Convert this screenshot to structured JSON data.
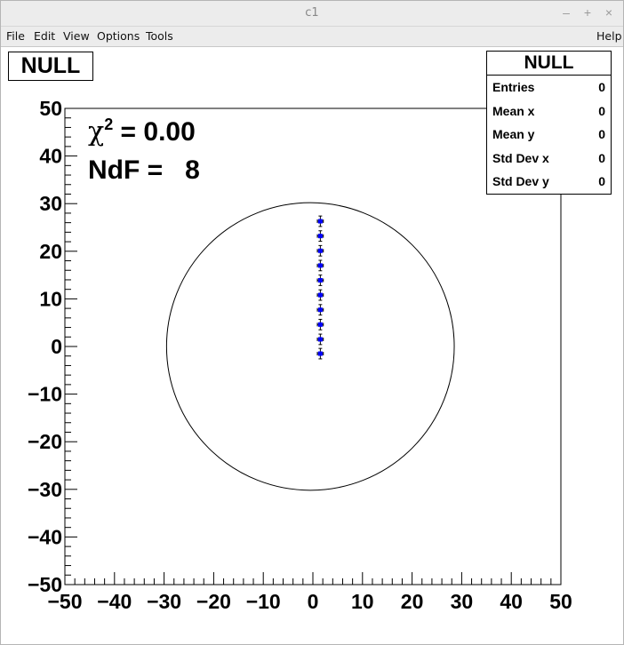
{
  "window": {
    "title": "c1",
    "buttons": [
      "–",
      "+",
      "×"
    ]
  },
  "menu": {
    "file": "File",
    "edit": "Edit",
    "view": "View",
    "options": "Options",
    "tools": "Tools",
    "help": "Help"
  },
  "histogram_title": "NULL",
  "stats": {
    "title": "NULL",
    "rows": [
      {
        "label": "Entries",
        "value": "0"
      },
      {
        "label": "Mean x",
        "value": "0"
      },
      {
        "label": "Mean y",
        "value": "0"
      },
      {
        "label": "Std Dev x",
        "value": "0"
      },
      {
        "label": "Std Dev y",
        "value": "0"
      }
    ]
  },
  "fit": {
    "chi2_symbol": "χ",
    "chi2_sup": "2",
    "chi2_value": " = 0.00",
    "ndf_line": "NdF =   8"
  },
  "colors": {
    "marker": "#0000ff",
    "axis": "#000000",
    "circle": "#000000"
  },
  "chart_data": {
    "type": "scatter",
    "title": "NULL",
    "xlabel": "",
    "ylabel": "",
    "xlim": [
      -50,
      50
    ],
    "ylim": [
      -50,
      50
    ],
    "x_ticks": [
      -50,
      -40,
      -30,
      -20,
      -10,
      0,
      10,
      20,
      30,
      40,
      50
    ],
    "y_ticks": [
      -50,
      -40,
      -30,
      -20,
      -10,
      0,
      10,
      20,
      30,
      40,
      50
    ],
    "series": [
      {
        "points": [
          {
            "x": 1.5,
            "y": -1.5
          },
          {
            "x": 1.5,
            "y": 1.5
          },
          {
            "x": 1.5,
            "y": 4.6
          },
          {
            "x": 1.5,
            "y": 7.7
          },
          {
            "x": 1.5,
            "y": 10.8
          },
          {
            "x": 1.5,
            "y": 13.9
          },
          {
            "x": 1.5,
            "y": 17.0
          },
          {
            "x": 1.5,
            "y": 20.1
          },
          {
            "x": 1.5,
            "y": 23.2
          },
          {
            "x": 1.5,
            "y": 26.3
          }
        ],
        "x_error": 0.6,
        "y_error": 1.1
      }
    ],
    "fit_circle": {
      "center_x": -0.5,
      "center_y": 0,
      "radius": 29
    }
  }
}
